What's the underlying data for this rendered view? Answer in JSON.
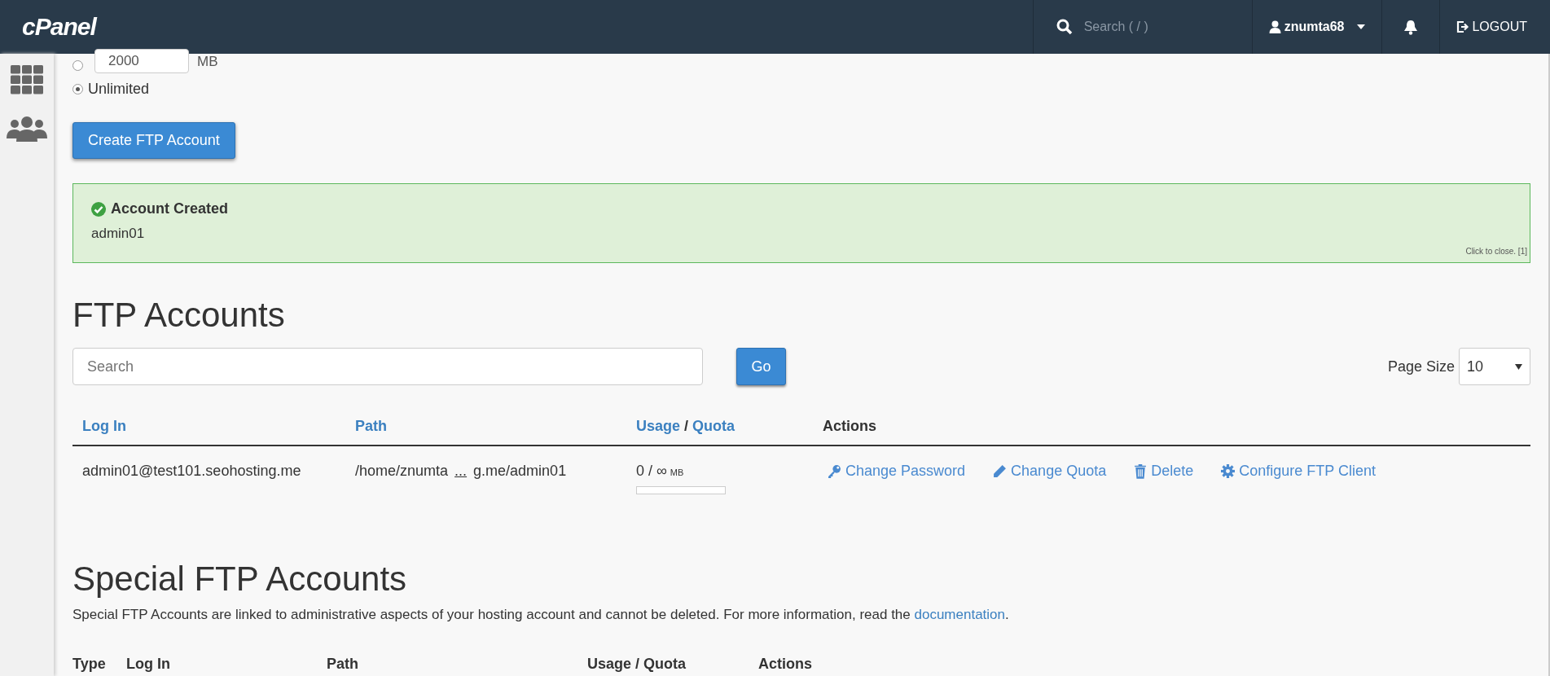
{
  "header": {
    "logo": "cPanel",
    "search": {
      "placeholder": "Search ( / )"
    },
    "user": "znumta68",
    "logout": "LOGOUT"
  },
  "quota_options": [
    {
      "kind": "amount",
      "value": "2000",
      "unit": "MB",
      "selected": false
    },
    {
      "kind": "label",
      "label": "Unlimited",
      "selected": true
    }
  ],
  "create_button": "Create FTP Account",
  "alert": {
    "title": "Account Created",
    "message": "admin01",
    "close_hint": "Click to close. [1]"
  },
  "ftp_accounts": {
    "title": "FTP Accounts",
    "search": {
      "placeholder": "Search"
    },
    "go_button": "Go",
    "page_size": {
      "label": "Page Size",
      "value": "10"
    },
    "columns": [
      {
        "kind": "sort",
        "parts": [
          "Log In"
        ]
      },
      {
        "kind": "sort",
        "parts": [
          "Path"
        ]
      },
      {
        "kind": "sort",
        "parts": [
          "Usage",
          "/",
          "Quota"
        ]
      },
      {
        "kind": "plain",
        "parts": [
          "Actions"
        ]
      }
    ],
    "rows": [
      {
        "login": "admin01@test101.seohosting.me",
        "path_start": "/home/znumta",
        "path_ellipsis": "...",
        "path_end": "g.me/admin01",
        "usage": "0 / ∞",
        "unit": "MB",
        "level": 0,
        "actions": [
          {
            "kind": "key",
            "label": "Change Password"
          },
          {
            "kind": "pencil",
            "label": "Change Quota"
          },
          {
            "kind": "trash",
            "label": "Delete"
          },
          {
            "kind": "gear",
            "label": "Configure FTP Client"
          }
        ]
      }
    ]
  },
  "special_ftp_accounts": {
    "title": "Special FTP Accounts",
    "description": "Special FTP Accounts are linked to administrative aspects of your hosting account and cannot be deleted. For more information, read the",
    "link": "documentation",
    "after_link": ".",
    "columns": [
      "Type",
      "Log In",
      "Path",
      "Usage / Quota",
      "Actions"
    ]
  }
}
